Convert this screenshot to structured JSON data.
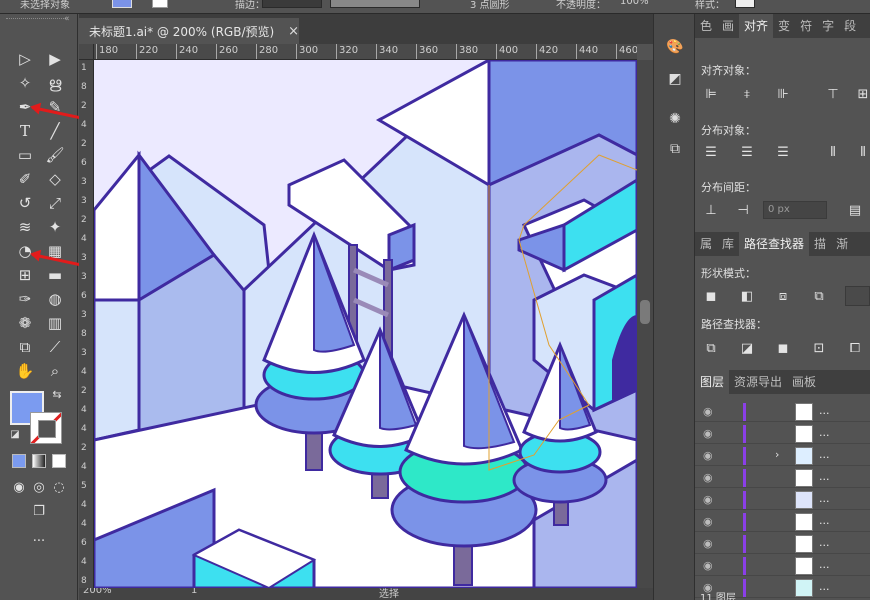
{
  "app": {
    "control_bar": {
      "left_label": "未选择对象",
      "stroke_label": "描边：",
      "style_label": "3 点圆形",
      "opacity_label": "不透明度：",
      "opacity_value": "100%",
      "style2_label": "样式："
    },
    "document_tab": {
      "title": "未标题1.ai* @ 200% (RGB/预览)",
      "close_icon": "×"
    },
    "ruler": {
      "h_ticks": [
        "180",
        "220",
        "240",
        "260",
        "280",
        "300",
        "320",
        "340",
        "360",
        "380",
        "400",
        "420",
        "440",
        "460"
      ],
      "v_ticks": [
        "1",
        "8",
        "2",
        "4",
        "2",
        "6",
        "3",
        "3",
        "2",
        "4",
        "3",
        "3",
        "6",
        "3",
        "8",
        "3",
        "4",
        "2",
        "4",
        "4",
        "2",
        "4",
        "5",
        "4",
        "4",
        "6",
        "4",
        "8"
      ]
    },
    "status": {
      "zoom": "200%",
      "artboard": "1",
      "mode": "选择"
    },
    "toolbar": {
      "tools": [
        "selection-tool",
        "direct-selection-tool",
        "magic-wand-tool",
        "lasso-tool",
        "pen-tool",
        "curvature-tool",
        "type-tool",
        "line-tool",
        "rectangle-tool",
        "paintbrush-tool",
        "shaper-tool",
        "eraser-tool",
        "rotate-tool",
        "scale-tool",
        "width-tool",
        "puppet-warp-tool",
        "shape-builder-tool",
        "perspective-tool",
        "mesh-tool",
        "gradient-tool",
        "eyedropper-tool",
        "blend-tool",
        "symbol-sprayer-tool",
        "graph-tool",
        "artboard-tool",
        "slice-tool",
        "hand-tool",
        "zoom-tool"
      ],
      "fill_color": "#7b9bf0",
      "stroke_color": "#ffffff",
      "more": "···"
    },
    "align_panel": {
      "tabs": [
        "色",
        "画",
        "对齐",
        "变",
        "符",
        "字",
        "段"
      ],
      "active_tab": "对齐",
      "align_objects_label": "对齐对象：",
      "distribute_objects_label": "分布对象：",
      "distribute_spacing_label": "分布间距：",
      "spacing_value": "0 px"
    },
    "pathfinder_panel": {
      "tabs": [
        "属",
        "库",
        "路径查找器",
        "描",
        "渐"
      ],
      "active_tab": "路径查找器",
      "shape_modes_label": "形状模式：",
      "pathfinders_label": "路径查找器："
    },
    "layers_panel": {
      "tabs": [
        "图层",
        "资源导出",
        "画板"
      ],
      "active_tab": "图层",
      "rows": [
        {
          "dots": "..."
        },
        {
          "dots": "..."
        },
        {
          "dots": "...",
          "expand": "›"
        },
        {
          "dots": "..."
        },
        {
          "dots": "..."
        },
        {
          "dots": "..."
        },
        {
          "dots": "..."
        },
        {
          "dots": "..."
        },
        {
          "dots": "..."
        }
      ],
      "footer": "11 图层"
    },
    "colors": {
      "purple": "#3f2aa0",
      "accent": "#7b9bf0",
      "cyan": "#3de0f0",
      "teal": "#2ee8c8"
    }
  }
}
